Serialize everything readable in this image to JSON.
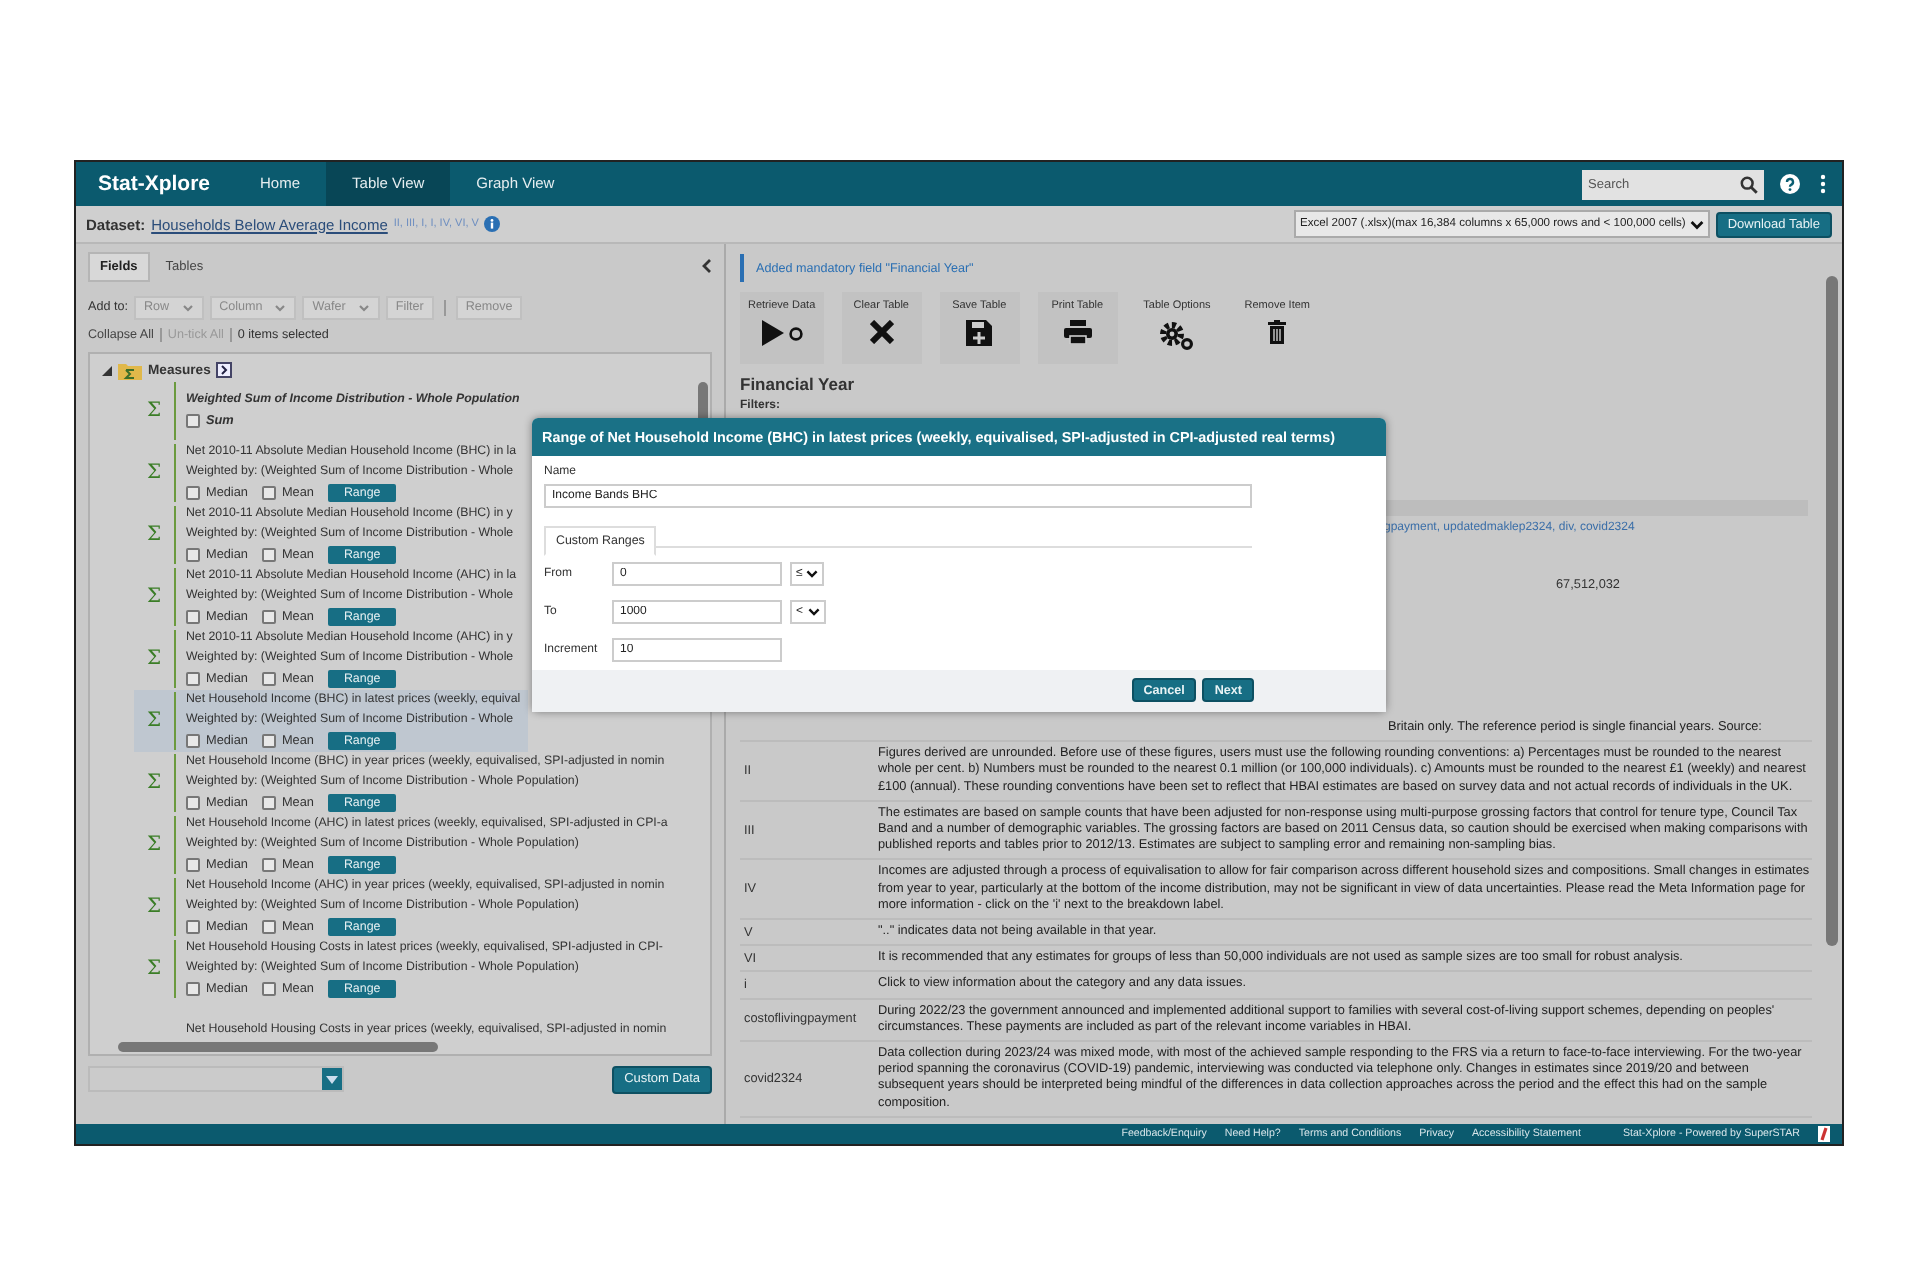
{
  "app": {
    "brand": "Stat-Xplore",
    "nav": [
      {
        "label": "Home",
        "selected": false
      },
      {
        "label": "Table View",
        "selected": true
      },
      {
        "label": "Graph View",
        "selected": false
      }
    ],
    "search": {
      "placeholder": "Search"
    }
  },
  "dataset": {
    "label": "Dataset:",
    "name": "Households Below Average Income",
    "footnotes": "II, III, I, I, IV, VI, V",
    "format": "Excel 2007 (.xlsx)(max 16,384 columns x 65,000 rows and < 100,000 cells)",
    "download": "Download Table"
  },
  "fields_panel": {
    "tabs": [
      {
        "label": "Fields",
        "selected": true
      },
      {
        "label": "Tables",
        "selected": false
      }
    ],
    "add_to_label": "Add to:",
    "add_to": [
      {
        "label": "Row",
        "kind": "split",
        "disabled": true
      },
      {
        "label": "Column",
        "kind": "split",
        "disabled": true
      },
      {
        "label": "Wafer",
        "kind": "split",
        "disabled": true
      },
      {
        "label": "Filter",
        "kind": "plain",
        "disabled": true
      },
      {
        "label": "Remove",
        "kind": "plain",
        "disabled": true
      }
    ],
    "tree_actions": [
      {
        "label": "Collapse All",
        "disabled": false
      },
      {
        "label": "Un-tick All",
        "disabled": true
      }
    ],
    "selection_count": "0 items selected",
    "tree": {
      "folder": "Measures",
      "expanded": true,
      "items": [
        {
          "symbol": "Σ",
          "title": "Weighted Sum of Income Distribution - Whole Population",
          "emphasis": true,
          "selected": false,
          "options": [
            {
              "label": "Sum",
              "checked": false
            }
          ]
        },
        {
          "symbol": "Σ",
          "title": "Net 2010-11 Absolute Median Household Income (BHC) in la",
          "weighted_by": "Weighted by: (Weighted Sum of Income Distribution - Whole",
          "emphasis": false,
          "selected": false,
          "options": [
            {
              "label": "Median",
              "checked": false
            },
            {
              "label": "Mean",
              "checked": false
            }
          ],
          "range": "Range"
        },
        {
          "symbol": "Σ",
          "title": "Net 2010-11 Absolute Median Household Income (BHC) in y",
          "weighted_by": "Weighted by: (Weighted Sum of Income Distribution - Whole",
          "emphasis": false,
          "selected": false,
          "options": [
            {
              "label": "Median",
              "checked": false
            },
            {
              "label": "Mean",
              "checked": false
            }
          ],
          "range": "Range"
        },
        {
          "symbol": "Σ",
          "title": "Net 2010-11 Absolute Median Household Income (AHC) in la",
          "weighted_by": "Weighted by: (Weighted Sum of Income Distribution - Whole",
          "emphasis": false,
          "selected": false,
          "options": [
            {
              "label": "Median",
              "checked": false
            },
            {
              "label": "Mean",
              "checked": false
            }
          ],
          "range": "Range"
        },
        {
          "symbol": "Σ",
          "title": "Net 2010-11 Absolute Median Household Income (AHC) in y",
          "weighted_by": "Weighted by: (Weighted Sum of Income Distribution - Whole",
          "emphasis": false,
          "selected": false,
          "options": [
            {
              "label": "Median",
              "checked": false
            },
            {
              "label": "Mean",
              "checked": false
            }
          ],
          "range": "Range"
        },
        {
          "symbol": "Σ",
          "title": "Net Household Income (BHC) in latest prices (weekly, equival",
          "weighted_by": "Weighted by: (Weighted Sum of Income Distribution - Whole",
          "emphasis": false,
          "selected": true,
          "options": [
            {
              "label": "Median",
              "checked": false
            },
            {
              "label": "Mean",
              "checked": false
            }
          ],
          "range": "Range"
        },
        {
          "symbol": "Σ",
          "title": "Net Household Income (BHC) in year prices (weekly, equivalised, SPI-adjusted in nomin",
          "weighted_by": "Weighted by: (Weighted Sum of Income Distribution - Whole Population)",
          "emphasis": false,
          "selected": false,
          "options": [
            {
              "label": "Median",
              "checked": false
            },
            {
              "label": "Mean",
              "checked": false
            }
          ],
          "range": "Range"
        },
        {
          "symbol": "Σ",
          "title": "Net Household Income (AHC) in latest prices (weekly, equivalised, SPI-adjusted in CPI-a",
          "weighted_by": "Weighted by: (Weighted Sum of Income Distribution - Whole Population)",
          "emphasis": false,
          "selected": false,
          "options": [
            {
              "label": "Median",
              "checked": false
            },
            {
              "label": "Mean",
              "checked": false
            }
          ],
          "range": "Range"
        },
        {
          "symbol": "Σ",
          "title": "Net Household Income (AHC) in year prices (weekly, equivalised, SPI-adjusted in nomin",
          "weighted_by": "Weighted by: (Weighted Sum of Income Distribution - Whole Population)",
          "emphasis": false,
          "selected": false,
          "options": [
            {
              "label": "Median",
              "checked": false
            },
            {
              "label": "Mean",
              "checked": false
            }
          ],
          "range": "Range"
        },
        {
          "symbol": "Σ",
          "title": "Net Household Housing Costs in latest prices (weekly, equivalised, SPI-adjusted in CPI-",
          "weighted_by": "Weighted by: (Weighted Sum of Income Distribution - Whole Population)",
          "emphasis": false,
          "selected": false,
          "options": [
            {
              "label": "Median",
              "checked": false
            },
            {
              "label": "Mean",
              "checked": false
            }
          ],
          "range": "Range"
        },
        {
          "title": "Net Household Housing Costs in year prices (weekly, equivalised, SPI-adjusted in nomin",
          "emphasis": false,
          "selected": false
        }
      ]
    },
    "custom_data": "Custom Data"
  },
  "table_panel": {
    "notice": "Added mandatory field \"Financial Year\"",
    "toolbar": [
      {
        "label": "Retrieve Data",
        "kind": "retrieve"
      },
      {
        "label": "Clear Table",
        "kind": "clear"
      },
      {
        "label": "Save Table",
        "kind": "save"
      },
      {
        "label": "Print Table",
        "kind": "print"
      },
      {
        "label": "Table Options",
        "kind": "options"
      },
      {
        "label": "Remove Item",
        "kind": "remove"
      }
    ],
    "heading": "Financial Year",
    "filters_label": "Filters:",
    "column_link": "gpayment, updatedmaklep2324, div, covid2324",
    "cell_value": "67,512,032",
    "notes": [
      {
        "text": "Britain only. The reference period is single financial years. Source:"
      },
      {
        "label": "II",
        "text": "Figures derived are unrounded. Before use of these figures, users must use the following rounding conventions: a) Percentages must be rounded to the nearest whole per cent. b) Numbers must be rounded to the nearest 0.1 million (or 100,000 individuals). c) Amounts must be rounded to the nearest £1 (weekly) and nearest £100 (annual). These rounding conventions have been set to reflect that HBAI estimates are based on survey data and not actual records of individuals in the UK."
      },
      {
        "label": "III",
        "text": "The estimates are based on sample counts that have been adjusted for non-response using multi-purpose grossing factors that control for tenure type, Council Tax Band and a number of demographic variables. The grossing factors are based on 2011 Census data, so caution should be exercised when making comparisons with published reports and tables prior to 2012/13. Estimates are subject to sampling error and remaining non-sampling bias."
      },
      {
        "label": "IV",
        "text": "Incomes are adjusted through a process of equivalisation to allow for fair comparison across different household sizes and compositions. Small changes in estimates from year to year, particularly at the bottom of the income distribution, may not be significant in view of data uncertainties. Please read the Meta Information page for more information - click on the 'i' next to the breakdown label."
      },
      {
        "label": "V",
        "text": "\"..\" indicates data not being available in that year."
      },
      {
        "label": "VI",
        "text": "It is recommended that any estimates for groups of less than 50,000 individuals are not used as sample sizes are too small for robust analysis."
      },
      {
        "label": "i",
        "text": "Click to view information about the category and any data issues."
      },
      {
        "label": "costoflivingpayment",
        "text": "During 2022/23 the government announced and implemented additional support to families with several cost-of-living support schemes, depending on peoples' circumstances. These payments are included as part of the relevant income variables in HBAI."
      },
      {
        "label": "covid2324",
        "text": "Data collection during 2023/24 was mixed mode, with most of the achieved sample responding to the FRS via a return to face-to-face interviewing. For the two-year period spanning the coronavirus (COVID-19) pandemic, interviewing was conducted via telephone only. Changes in estimates since 2019/20 and between subsequent years should be interpreted being mindful of the differences in data collection approaches across the period and the effect this had on the sample composition."
      }
    ]
  },
  "dialog": {
    "title": "Range of Net Household Income (BHC) in latest prices (weekly, equivalised, SPI-adjusted in CPI-adjusted real terms)",
    "name_label": "Name",
    "name_value": "Income Bands BHC",
    "tab": "Custom Ranges",
    "fields": [
      {
        "label": "From",
        "value": "0",
        "operator": "≤"
      },
      {
        "label": "To",
        "value": "1000",
        "operator": "<"
      },
      {
        "label": "Increment",
        "value": "10"
      }
    ],
    "buttons": [
      "Cancel",
      "Next"
    ]
  },
  "footer": {
    "links": [
      "Feedback/Enquiry",
      "Need Help?",
      "Terms and Conditions",
      "Privacy",
      "Accessibility Statement"
    ],
    "powered": "Stat-Xplore - Powered by SuperSTAR"
  }
}
